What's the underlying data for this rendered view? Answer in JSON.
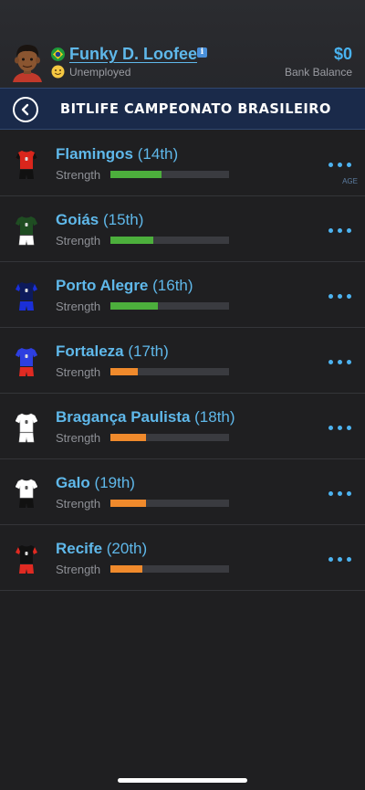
{
  "header": {
    "name": "Funky D. Loofee",
    "status": "Unemployed",
    "balance": "$0",
    "balance_label": "Bank Balance",
    "faint_text": "AGE"
  },
  "league": {
    "title": "BITLIFE CAMPEONATO BRASILEIRO"
  },
  "strength_label": "Strength",
  "teams": [
    {
      "name": "Flamingos",
      "rank": "(14th)",
      "strength": 0.43,
      "bar_color": "#4caf3c"
    },
    {
      "name": "Goiás",
      "rank": "(15th)",
      "strength": 0.36,
      "bar_color": "#4caf3c"
    },
    {
      "name": "Porto Alegre",
      "rank": "(16th)",
      "strength": 0.4,
      "bar_color": "#4caf3c"
    },
    {
      "name": "Fortaleza",
      "rank": "(17th)",
      "strength": 0.23,
      "bar_color": "#f08a2c"
    },
    {
      "name": "Bragança Paulista",
      "rank": "(18th)",
      "strength": 0.3,
      "bar_color": "#f08a2c"
    },
    {
      "name": "Galo",
      "rank": "(19th)",
      "strength": 0.3,
      "bar_color": "#f08a2c"
    },
    {
      "name": "Recife",
      "rank": "(20th)",
      "strength": 0.27,
      "bar_color": "#f08a2c"
    }
  ],
  "kits": [
    {
      "icon": "red-black-jersey-icon",
      "shirt": "#d9261c",
      "sleeve": "#111111",
      "shorts": "#111111"
    },
    {
      "icon": "green-white-jersey-icon",
      "shirt": "#1f4d22",
      "sleeve": "#1f4d22",
      "shorts": "#ffffff"
    },
    {
      "icon": "navy-blue-jersey-icon",
      "shirt": "#0d1a5c",
      "sleeve": "#1a2fd9",
      "shorts": "#1a2fd9"
    },
    {
      "icon": "blue-red-jersey-icon",
      "shirt": "#2d3fe0",
      "sleeve": "#2d3fe0",
      "shorts": "#e02a22"
    },
    {
      "icon": "white-jersey-icon",
      "shirt": "#ffffff",
      "sleeve": "#ffffff",
      "shorts": "#ffffff"
    },
    {
      "icon": "white-black-jersey-icon",
      "shirt": "#ffffff",
      "sleeve": "#ffffff",
      "shorts": "#111111"
    },
    {
      "icon": "black-red-jersey-icon",
      "shirt": "#111111",
      "sleeve": "#e02a22",
      "shorts": "#e02a22"
    }
  ],
  "colors": {
    "accent": "#5fb8ea",
    "background": "#1f1f21",
    "header_bar": "#1a2a4a"
  }
}
